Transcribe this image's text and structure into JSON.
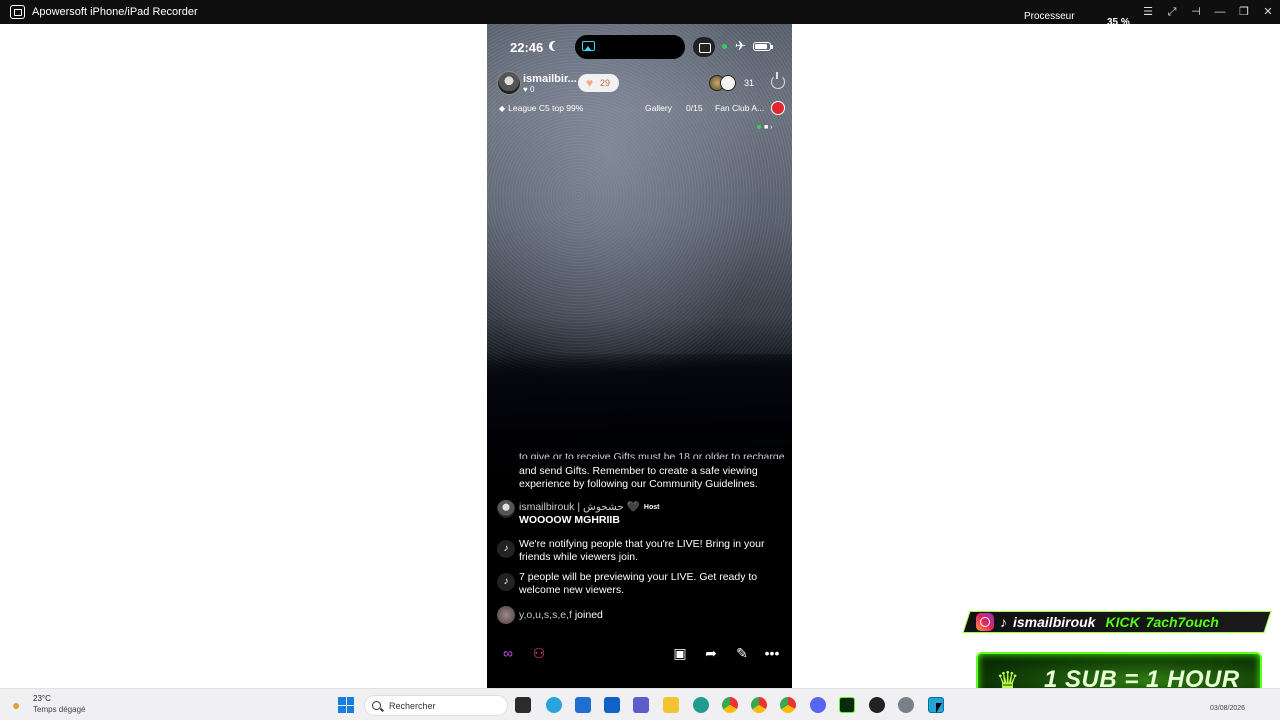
{
  "window": {
    "title": "Apowersoft iPhone/iPad Recorder",
    "cpu_label": "Processeur",
    "cpu_value": "35 %"
  },
  "phone": {
    "status": {
      "time": "22:46"
    },
    "host": {
      "name": "ismailbir...",
      "likes": "0",
      "like_count": "29"
    },
    "viewers": {
      "count": "31"
    },
    "league": {
      "text": "League C5 top 99%"
    },
    "gallery": {
      "label": "Gallery",
      "count": "0/15"
    },
    "fan_club": {
      "label": "Fan Club A..."
    },
    "chat": {
      "guidelines_partial": "to give or to receive Gifts must be 18 or older to recharge",
      "guidelines_1": "and send Gifts. Remember to create a safe viewing",
      "guidelines_2": "experience by following our Community Guidelines.",
      "host_msg_user": "ismailbirouk | حشحوش",
      "host_tag": "Host",
      "host_msg_text": "WOOOOW MGHRIIB",
      "notify_1": "We're notifying people that you're LIVE! Bring in your friends while viewers join.",
      "notify_2": "7 people will be previewing your LIVE. Get ready to welcome new viewers.",
      "joined_user": "y,o,u,s,s,e,f",
      "joined_text": "joined"
    }
  },
  "overlay": {
    "social_user": "ismailbirouk",
    "kick_label": "KICK",
    "kick_user": "7ach7ouch",
    "sub_text": "1 SUB = 1 HOUR"
  },
  "taskbar": {
    "weather_temp": "23°C",
    "weather_desc": "Temps dégagé",
    "search_placeholder": "Rechercher",
    "date": "03/08/2026"
  },
  "colors": {
    "kick_green": "#53fc18",
    "sub_border": "#5dff1f",
    "windows_blue": "#1a7de0"
  }
}
